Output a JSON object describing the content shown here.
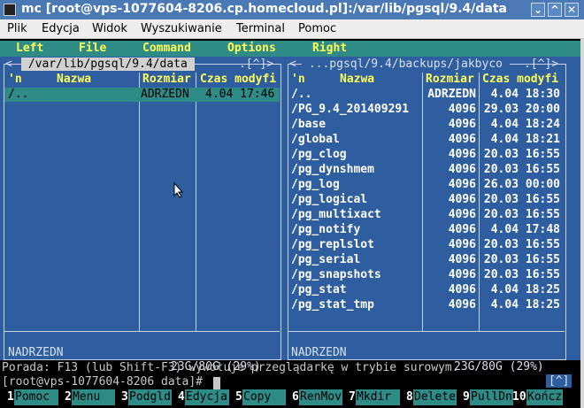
{
  "window": {
    "title": "mc [root@vps-1077604-8206.cp.homecloud.pl]:/var/lib/pgsql/9.4/data",
    "minimize": "⌄",
    "maximize": "^",
    "close": "✕"
  },
  "menubar": [
    "Plik",
    "Edycja",
    "Widok",
    "Wyszukiwanie",
    "Terminal",
    "Pomoc"
  ],
  "mc_menu": [
    "Left",
    "File",
    "Command",
    "Options",
    "Right"
  ],
  "left_panel": {
    "corner": "<",
    "path": " /var/lib/pgsql/9.4/data ",
    "path_controls": ".[^]>",
    "headers": {
      "n": "'n",
      "name": "Nazwa",
      "size": "Rozmiar",
      "time": "Czas modyfi"
    },
    "rows": [
      {
        "name": "/..",
        "size": "ADRZEDN",
        "time": "4.04 17:46"
      }
    ],
    "footer": "NADRZEDN",
    "disk": "23G/80G (29%)"
  },
  "right_panel": {
    "corner": "<",
    "path": " ...pgsql/9.4/backups/jakbyco ",
    "path_controls": ".[^]>",
    "headers": {
      "n": "'n",
      "name": "Nazwa",
      "size": "Rozmiar",
      "time": "Czas modyfi"
    },
    "rows": [
      {
        "name": "/..",
        "size": "ADRZEDN",
        "time": "4.04 18:30"
      },
      {
        "name": "/PG_9.4_201409291",
        "size": "4096",
        "time": "29.03 20:00"
      },
      {
        "name": "/base",
        "size": "4096",
        "time": "4.04 18:24"
      },
      {
        "name": "/global",
        "size": "4096",
        "time": "4.04 18:21"
      },
      {
        "name": "/pg_clog",
        "size": "4096",
        "time": "20.03 16:55"
      },
      {
        "name": "/pg_dynshmem",
        "size": "4096",
        "time": "20.03 16:55"
      },
      {
        "name": "/pg_log",
        "size": "4096",
        "time": "26.03 00:00"
      },
      {
        "name": "/pg_logical",
        "size": "4096",
        "time": "20.03 16:55"
      },
      {
        "name": "/pg_multixact",
        "size": "4096",
        "time": "20.03 16:55"
      },
      {
        "name": "/pg_notify",
        "size": "4096",
        "time": "4.04 17:48"
      },
      {
        "name": "/pg_replslot",
        "size": "4096",
        "time": "20.03 16:55"
      },
      {
        "name": "/pg_serial",
        "size": "4096",
        "time": "20.03 16:55"
      },
      {
        "name": "/pg_snapshots",
        "size": "4096",
        "time": "20.03 16:55"
      },
      {
        "name": "/pg_stat",
        "size": "4096",
        "time": "4.04 18:25"
      },
      {
        "name": "/pg_stat_tmp",
        "size": "4096",
        "time": "4.04 18:25"
      }
    ],
    "footer": "NADRZEDN",
    "disk": "23G/80G (29%)"
  },
  "hint": "Porada: F13 (lub Shift-F3) wywołuje przeglądarkę w trybie surowym.",
  "prompt": "[root@vps-1077604-8206 data]# ",
  "prompt_control": "[^]",
  "fkeys": [
    {
      "num": "1",
      "label": "Pomoc"
    },
    {
      "num": "2",
      "label": "Menu"
    },
    {
      "num": "3",
      "label": "Podgld"
    },
    {
      "num": "4",
      "label": "Edycja"
    },
    {
      "num": "5",
      "label": "Copy"
    },
    {
      "num": "6",
      "label": "RenMov"
    },
    {
      "num": "7",
      "label": "Mkdir"
    },
    {
      "num": "8",
      "label": "Delete"
    },
    {
      "num": "9",
      "label": "PullDn"
    },
    {
      "num": "10",
      "label": "Kończ"
    }
  ],
  "colors": {
    "panel": "#2f5ea0",
    "menu": "#2e8b86",
    "highlight": "#ffff55",
    "titlebar": "#4a79b5"
  }
}
